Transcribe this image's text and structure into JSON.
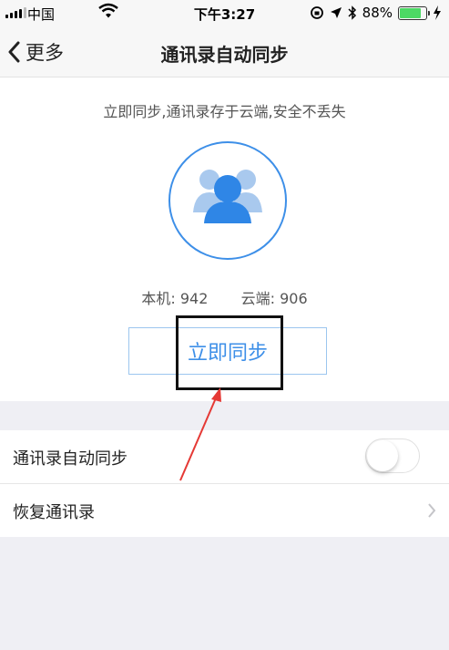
{
  "status_bar": {
    "carrier": "中国",
    "time": "下午3:27",
    "battery_percent": "88%",
    "battery_level": 0.88,
    "icons": [
      "signal-icon",
      "wifi-icon",
      "rotation-lock-icon",
      "location-icon",
      "bluetooth-icon",
      "battery-icon",
      "charging-icon"
    ]
  },
  "nav": {
    "back_label": "更多",
    "title": "通讯录自动同步"
  },
  "hero": {
    "tagline": "立即同步,通讯录存于云端,安全不丢失",
    "local_label": "本机:",
    "local_count": "942",
    "cloud_label": "云端:",
    "cloud_count": "906",
    "sync_button_label": "立即同步"
  },
  "settings": {
    "auto_sync_label": "通讯录自动同步",
    "auto_sync_enabled": false,
    "restore_label": "恢复通讯录"
  },
  "colors": {
    "accent": "#3d8fe8",
    "annotation_arrow": "#e53935",
    "highlight_box": "#111111"
  }
}
